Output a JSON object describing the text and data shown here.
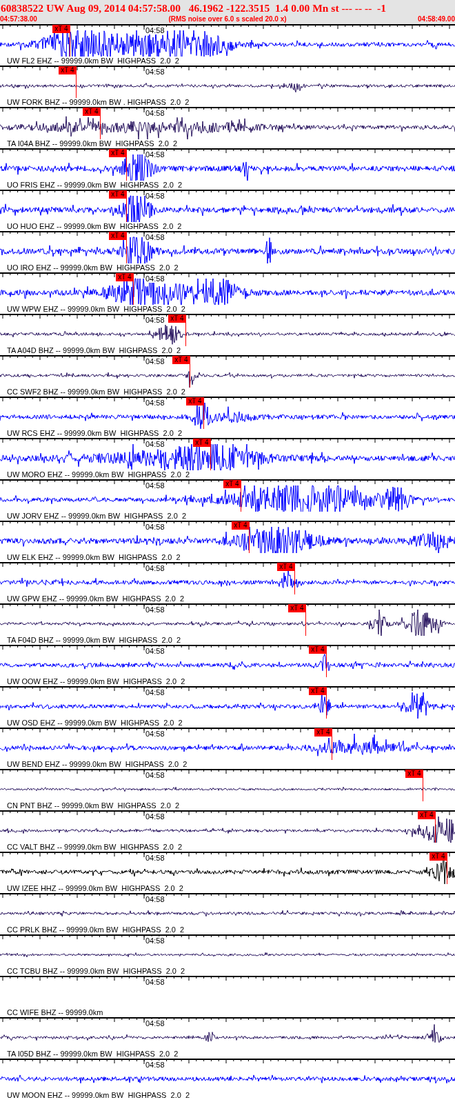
{
  "header": {
    "title": "60838522 UW Aug 09, 2014 04:57:58.00   46.1962 -122.3515  1.4 0.00 Mn st --- -- --  -1",
    "start_time": "04:57:38.00",
    "note": "(RMS noise over 6.0 s scaled 20.0 x)",
    "end_time": "04:58:49.00"
  },
  "traces": [
    {
      "kind": "wave",
      "label": "UW FL2 EHZ -- 99999.0km BW  HIGHPASS  2.0  2",
      "time": "04:58",
      "pick": "xT 4",
      "color": "#0000ff"
    },
    {
      "kind": "wave",
      "label": "UW FORK BHZ -- 99999.0km BW . HIGHPASS  2.0  2",
      "time": "04:58",
      "pick": "xT 4",
      "color": "#2a1660"
    },
    {
      "kind": "wave",
      "label": "TA I04A BHZ -- 99999.0km BW  HIGHPASS  2.0  2",
      "time": "04:58",
      "pick": "xT 4",
      "color": "#2a1660"
    },
    {
      "kind": "wave",
      "label": "UO FRIS EHZ -- 99999.0km BW  HIGHPASS  2.0  2",
      "time": "04:58",
      "pick": "xT 4",
      "color": "#0000ff"
    },
    {
      "kind": "wave",
      "label": "UO HUO EHZ -- 99999.0km BW  HIGHPASS  2.0  2",
      "time": "04:58",
      "pick": "xT 4",
      "color": "#0000ff"
    },
    {
      "kind": "wave",
      "label": "UO IRO EHZ -- 99999.0km BW  HIGHPASS  2.0  2",
      "time": "04:58",
      "pick": "xT 4",
      "color": "#0000ff"
    },
    {
      "kind": "wave",
      "label": "UW WPW EHZ -- 99999.0km BW  HIGHPASS  2.0  2",
      "time": "04:58",
      "pick": "xT 4",
      "color": "#0000ff"
    },
    {
      "kind": "wave",
      "label": "TA A04D BHZ -- 99999.0km BW  HIGHPASS  2.0  2",
      "time": "04:58",
      "pick": "xT 4",
      "color": "#2a1660"
    },
    {
      "kind": "wave",
      "label": "CC SWF2 BHZ -- 99999.0km BW  HIGHPASS  2.0  2",
      "time": "04:58",
      "pick": "xT 4",
      "color": "#2a1660"
    },
    {
      "kind": "wave",
      "label": "UW RCS EHZ -- 99999.0km BW  HIGHPASS  2.0  2",
      "time": "04:58",
      "pick": "xT 4",
      "color": "#0000ff"
    },
    {
      "kind": "wave",
      "label": "UW MORO EHZ -- 99999.0km BW  HIGHPASS  2.0  2",
      "time": "04:58",
      "pick": "xT 4",
      "color": "#0000ff"
    },
    {
      "kind": "wave",
      "label": "UW JORV EHZ -- 99999.0km BW  HIGHPASS  2.0  2",
      "time": "04:58",
      "pick": "xT 4",
      "color": "#0000ff"
    },
    {
      "kind": "wave",
      "label": "UW ELK EHZ -- 99999.0km BW  HIGHPASS  2.0  2",
      "time": "04:58",
      "pick": "xT 4",
      "color": "#0000ff"
    },
    {
      "kind": "wave",
      "label": "UW GPW EHZ -- 99999.0km BW  HIGHPASS  2.0  2",
      "time": "04:58",
      "pick": "xT 4",
      "color": "#0000ff"
    },
    {
      "kind": "wave",
      "label": "TA F04D BHZ -- 99999.0km BW  HIGHPASS  2.0  2",
      "time": "04:58",
      "pick": "xT 4",
      "color": "#2a1660"
    },
    {
      "kind": "wave",
      "label": "UW OOW EHZ -- 99999.0km BW  HIGHPASS  2.0  2",
      "time": "04:58",
      "pick": "xT 4",
      "color": "#0000ff"
    },
    {
      "kind": "wave",
      "label": "UW OSD EHZ -- 99999.0km BW  HIGHPASS  2.0  2",
      "time": "04:58",
      "pick": "xT 4",
      "color": "#0000ff"
    },
    {
      "kind": "wave",
      "label": "UW BEND EHZ -- 99999.0km BW  HIGHPASS  2.0  2",
      "time": "04:58",
      "pick": "xT 4",
      "color": "#0000ff"
    },
    {
      "kind": "wave",
      "label": "CN PNT BHZ -- 99999.0km BW  HIGHPASS  2.0  2",
      "time": "04:58",
      "pick": "xT 4",
      "color": "#2a1660"
    },
    {
      "kind": "wave",
      "label": "CC VALT BHZ -- 99999.0km BW  HIGHPASS  2.0  2",
      "time": "04:58",
      "pick": "xT 4",
      "color": "#2a1660"
    },
    {
      "kind": "wave",
      "label": "UW IZEE HHZ -- 99999.0km BW  HIGHPASS  2.0  2",
      "time": "04:58",
      "pick": "xT 4",
      "color": "#000000"
    },
    {
      "kind": "wave",
      "label": "CC PRLK BHZ -- 99999.0km BW  HIGHPASS  2.0  2",
      "time": "04:58",
      "color": "#2a1660"
    },
    {
      "kind": "wave",
      "label": "CC TCBU BHZ -- 99999.0km BW  HIGHPASS  2.0  2",
      "time": "04:58",
      "color": "#2a1660"
    },
    {
      "kind": "empty",
      "label": "CC WIFE BHZ -- 99999.0km",
      "time": "04:58"
    },
    {
      "kind": "wave",
      "label": "TA I05D BHZ -- 99999.0km BW  HIGHPASS  2.0  2",
      "time": "04:58",
      "color": "#2a1660"
    },
    {
      "kind": "wave",
      "label": "UW MOON EHZ -- 99999.0km BW  HIGHPASS  2.0  2",
      "time": "04:58",
      "color": "#0000ff"
    }
  ]
}
